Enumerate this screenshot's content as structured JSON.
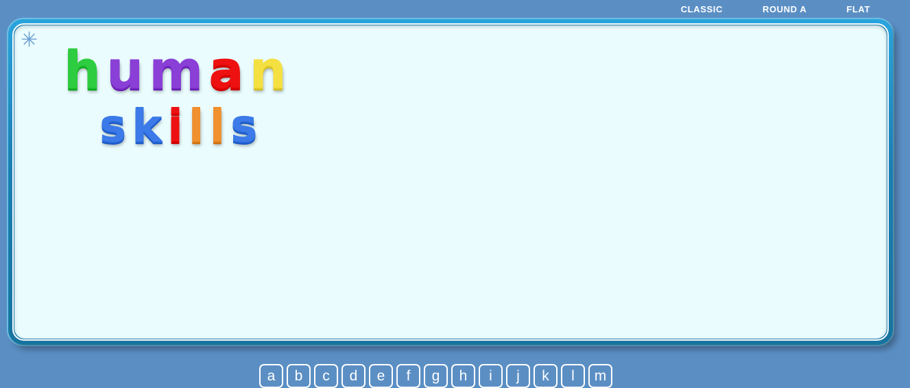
{
  "app": {
    "background_color": "#5b8fc4",
    "board_color": "#eafcfe",
    "board_frame_color": "#1b7fb4"
  },
  "topnav": {
    "items": [
      {
        "label": "CLASSIC",
        "name": "nav-classic"
      },
      {
        "label": "ROUND A",
        "name": "nav-round-a"
      },
      {
        "label": "FLAT",
        "name": "nav-flat"
      }
    ]
  },
  "board": {
    "badge_icon": "asterisk-icon",
    "badge_glyph": "✳",
    "words": [
      {
        "text": "human",
        "letters": [
          {
            "char": "h",
            "color": "#2ecc40"
          },
          {
            "char": "u",
            "color": "#8a3fd6"
          },
          {
            "char": "m",
            "color": "#8a3fd6"
          },
          {
            "char": "a",
            "color": "#ee1111"
          },
          {
            "char": "n",
            "color": "#f5e042"
          }
        ]
      },
      {
        "text": "skills",
        "letters": [
          {
            "char": "s",
            "color": "#3b7ae8"
          },
          {
            "char": "k",
            "color": "#3b7ae8"
          },
          {
            "char": "i",
            "color": "#ee1111"
          },
          {
            "char": "l",
            "color": "#f0902e"
          },
          {
            "char": "l",
            "color": "#f0902e"
          },
          {
            "char": "s",
            "color": "#3b7ae8"
          }
        ]
      }
    ]
  },
  "tray": {
    "tiles": [
      "a",
      "b",
      "c",
      "d",
      "e",
      "f",
      "g",
      "h",
      "i",
      "j",
      "k",
      "l",
      "m"
    ]
  }
}
